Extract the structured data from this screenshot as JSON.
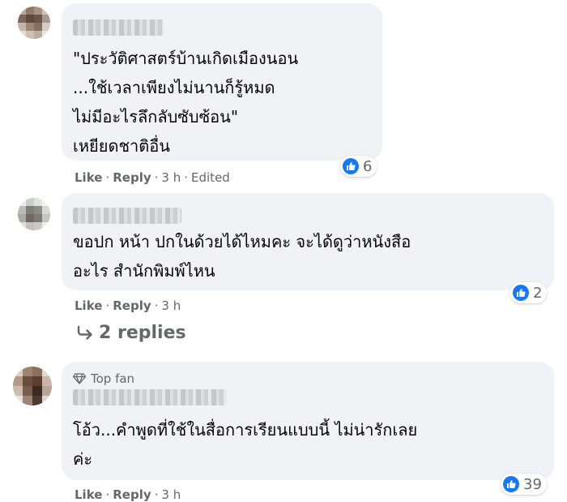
{
  "comments": [
    {
      "text": "\"ประวัติศาสตร์บ้านเกิดเมืองนอน\n...ใช้เวลาเพียงไม่นานก็รู้หมด\nไม่มีอะไรลึกลับซับซ้อน\"\nเหยียดชาติอื่น",
      "like": "Like",
      "reply": "Reply",
      "time": "3 h",
      "edited": "Edited",
      "reaction_count": "6"
    },
    {
      "text": "ขอปก หน้า ปกในด้วยได้ไหมคะ จะได้ดูว่าหนังสือ\nอะไร สำนักพิมพ์ไหน",
      "like": "Like",
      "reply": "Reply",
      "time": "3 h",
      "reaction_count": "2",
      "replies_label": "2 replies"
    },
    {
      "badge": "Top fan",
      "text": "โอ้ว...คำพูดที่ใช้ในสื่อการเรียนแบบนี้ ไม่น่ารักเลย\nค่ะ",
      "like": "Like",
      "reply": "Reply",
      "time": "3 h",
      "reaction_count": "39"
    }
  ],
  "icons": {
    "like": "thumbs-up-icon",
    "reply_arrow": "reply-arrow-icon",
    "top_fan": "diamond-icon"
  },
  "colors": {
    "bubble": "#f0f2f5",
    "meta_text": "#65676b",
    "like_blue": "#1877f2"
  }
}
